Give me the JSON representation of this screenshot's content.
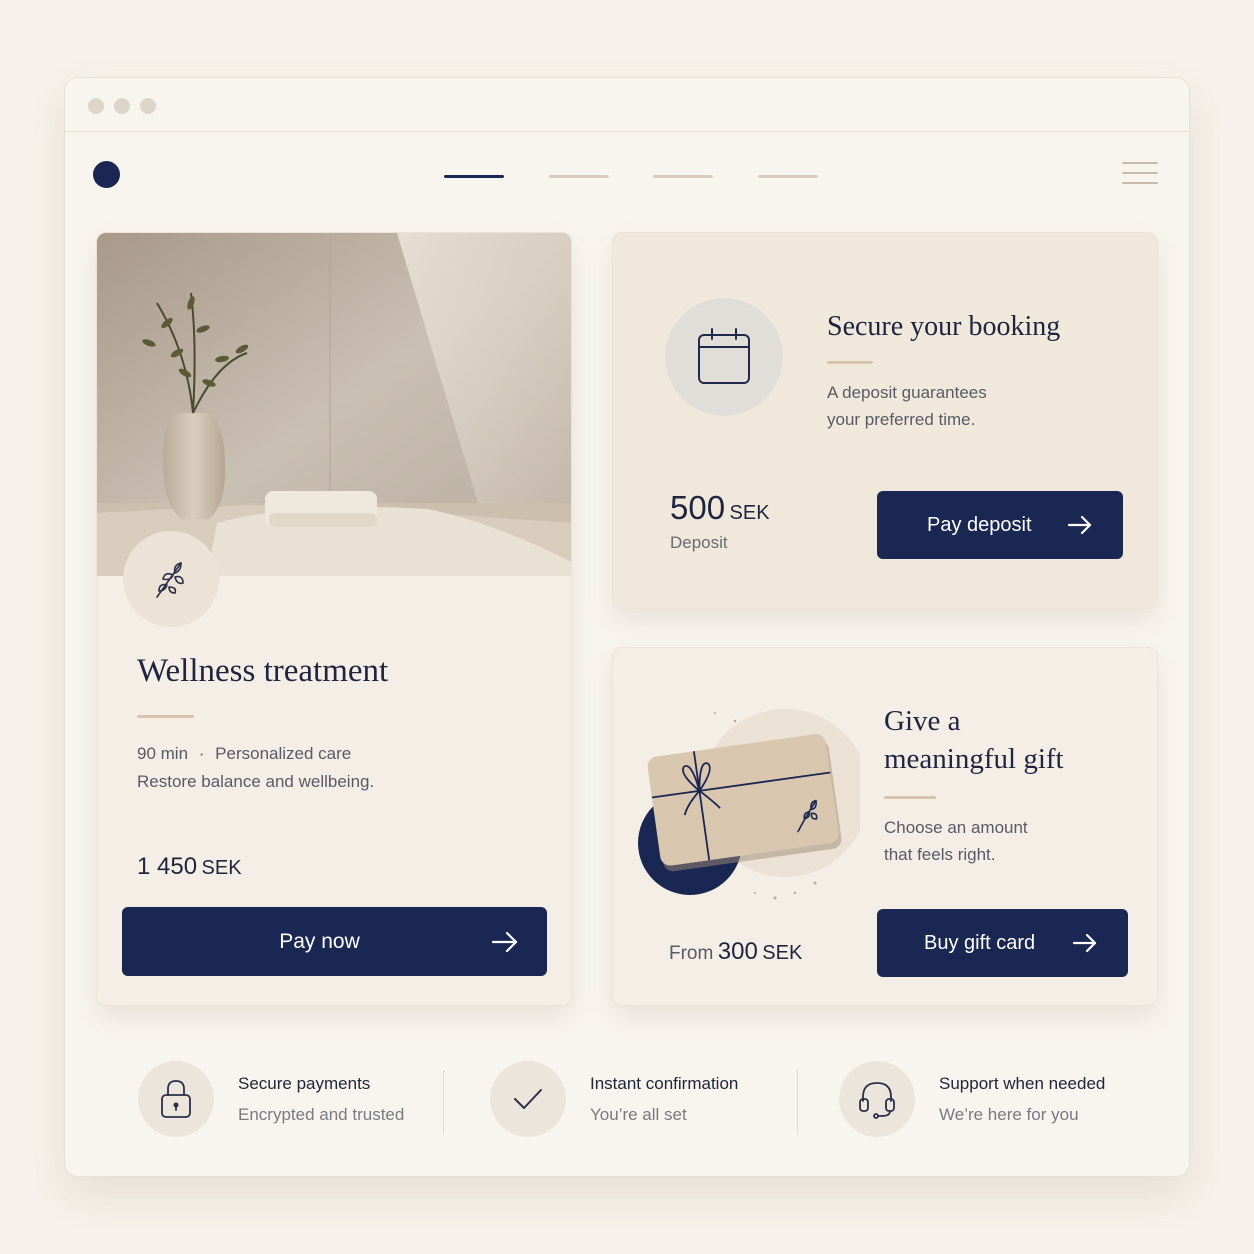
{
  "nav": {
    "items": [
      "",
      "",
      "",
      ""
    ],
    "active_index": 0
  },
  "treatment": {
    "title": "Wellness treatment",
    "duration": "90 min",
    "separator": "·",
    "feature": "Personalized care",
    "description": "Restore balance and wellbeing.",
    "price_amount": "1 450",
    "price_currency": "SEK",
    "button_label": "Pay now"
  },
  "deposit": {
    "title": "Secure your booking",
    "description_line1": "A deposit guarantees",
    "description_line2": "your preferred time.",
    "price_amount": "500",
    "price_currency": "SEK",
    "price_label": "Deposit",
    "button_label": "Pay deposit"
  },
  "gift": {
    "title_line1": "Give a",
    "title_line2": "meaningful gift",
    "description_line1": "Choose an amount",
    "description_line2": "that feels right.",
    "from_label": "From",
    "price_amount": "300",
    "price_currency": "SEK",
    "button_label": "Buy gift card"
  },
  "features": [
    {
      "title": "Secure payments",
      "subtitle": "Encrypted and trusted",
      "icon": "lock-icon"
    },
    {
      "title": "Instant confirmation",
      "subtitle": "You’re all set",
      "icon": "check-icon"
    },
    {
      "title": "Support when needed",
      "subtitle": "We’re here for you",
      "icon": "headset-icon"
    }
  ],
  "colors": {
    "primary": "#1b2753",
    "background": "#f6f1ea",
    "card": "#f3ede5",
    "accent": "#d8c3ad"
  }
}
